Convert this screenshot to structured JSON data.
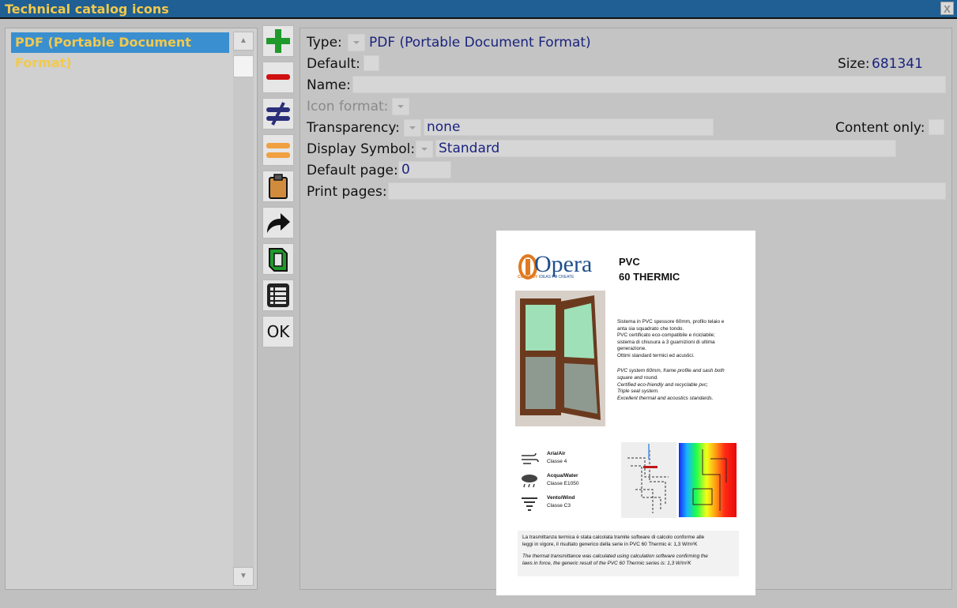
{
  "window": {
    "title": "Technical catalog icons",
    "close_label": "X"
  },
  "list": {
    "items": [
      {
        "label": "PDF (Portable Document Format)"
      }
    ]
  },
  "toolbar": {
    "buttons": [
      {
        "icon": "plus-icon",
        "color": "#1f9a2a"
      },
      {
        "icon": "minus-icon",
        "color": "#d01010"
      },
      {
        "icon": "not-equal-icon",
        "color": "#2b2f7a"
      },
      {
        "icon": "equal-icon",
        "color": "#f0a040"
      },
      {
        "icon": "clipboard-icon",
        "color": "#d08c3c"
      },
      {
        "icon": "forward-arrow-icon",
        "color": "#111111"
      },
      {
        "icon": "green-frame-icon",
        "color": "#1f9a2a"
      },
      {
        "icon": "list-grid-icon",
        "color": "#222222"
      }
    ],
    "ok_label": "OK"
  },
  "form": {
    "type_label": "Type:",
    "type_value": "PDF (Portable Document Format)",
    "default_label": "Default:",
    "size_label": "Size:",
    "size_value": "681341",
    "name_label": "Name:",
    "name_value": "",
    "icon_format_label": "Icon format:",
    "transparency_label": "Transparency:",
    "transparency_value": "none",
    "content_only_label": "Content only:",
    "display_symbol_label": "Display Symbol:",
    "display_symbol_value": "Standard",
    "default_page_label": "Default page:",
    "default_page_value": "0",
    "print_pages_label": "Print pages:",
    "print_pages_value": ""
  },
  "preview": {
    "logo_text": "Opera",
    "logo_company": "COMPANY",
    "logo_tagline": "IDEAS TO CREATE",
    "product_line1": "PVC",
    "product_line2": "60 THERMIC",
    "desc_it": [
      "Sistema in PVC spessore 60mm, profilo telaio e",
      "anta sia squadrato che tondo.",
      "PVC certificato eco-compatibile e riciclabile;",
      "sistema di chiusura a 3 guarnizioni di ultima",
      "generazione.",
      "Ottimi standard termici ed acustici."
    ],
    "desc_en": [
      "PVC system 60mm, frame profile and sash both",
      "square and round.",
      "Certified eco-friendly and recyclable pvc;",
      "Triple seal system.",
      "Excellent thermal and acoustics standards."
    ],
    "ratings": [
      {
        "icon": "wind-air-icon",
        "title": "Aria/Air",
        "value": "Classe 4"
      },
      {
        "icon": "rain-water-icon",
        "title": "Acqua/Water",
        "value": "Classe E1050"
      },
      {
        "icon": "tornado-wind-icon",
        "title": "Vento/Wind",
        "value": "Classe C3"
      }
    ],
    "note_it": [
      "La trasmittanza termica è stata calcolata tramite software di calcolo conforme alle",
      "leggi in vigore, il risultato generico della serie in PVC 60 Thermic è: 1,3 W/m²K"
    ],
    "note_en": [
      "The thermal transmittance was calculated using calculation software confirming the",
      "laws in force, the generic result of the PVC 60 Thermic series is: 1,3 W/m²K"
    ]
  }
}
